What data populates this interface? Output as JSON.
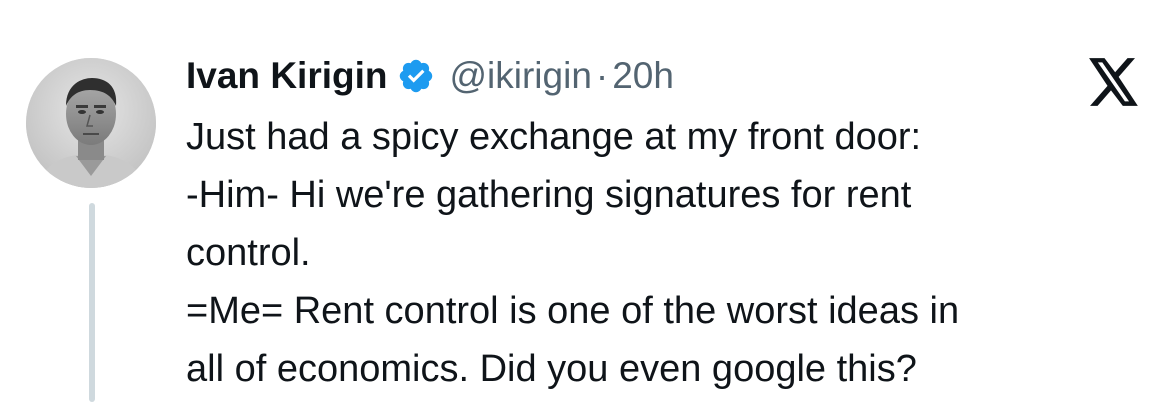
{
  "author": {
    "name": "Ivan Kirigin",
    "handle": "@ikirigin",
    "separator": "·",
    "time": "20h",
    "verified": true,
    "verified_color": "#1d9bf0"
  },
  "tweet": {
    "lines": [
      "Just had a spicy exchange at my front door:",
      "-Him- Hi we're gathering signatures for rent",
      "control.",
      "=Me= Rent control is one of the worst ideas in",
      "all of economics. Did you even google this?"
    ]
  },
  "icons": {
    "avatar": "profile-photo",
    "badge": "verified-badge-icon",
    "brand": "x-logo-icon"
  }
}
